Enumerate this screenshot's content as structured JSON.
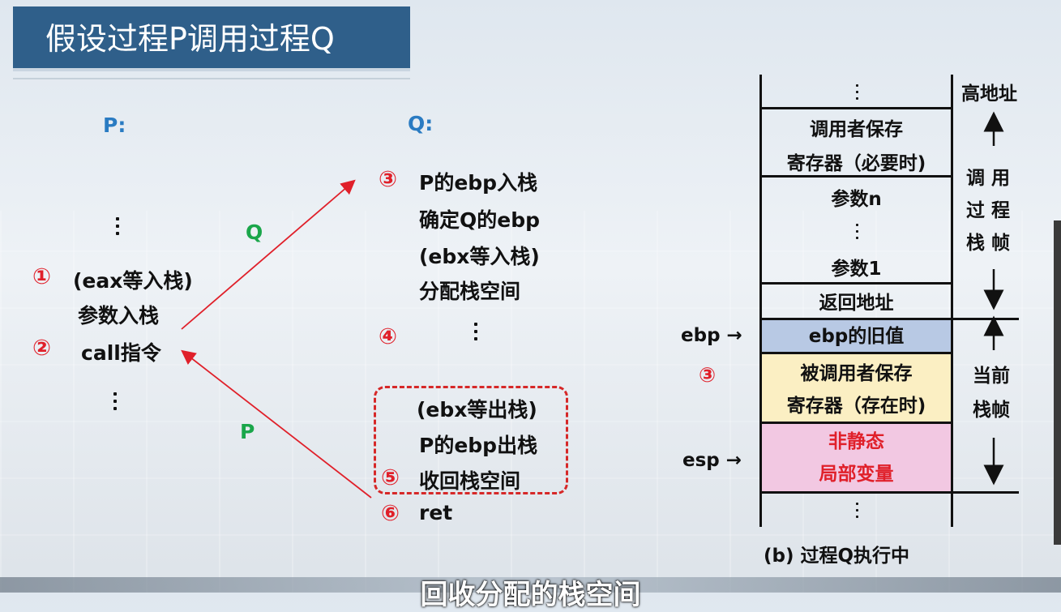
{
  "title": "假设过程P调用过程Q",
  "p_side": {
    "label": "P:",
    "step1_num": "①",
    "step1_text": "(eax等入栈)",
    "step1_sub": "参数入栈",
    "step2_num": "②",
    "step2_text": "call指令"
  },
  "arrows": {
    "call_label": "Q",
    "return_label": "P"
  },
  "q_side": {
    "label": "Q:",
    "step3_num": "③",
    "lines": [
      "P的ebp入栈",
      "确定Q的ebp",
      "(ebx等入栈)",
      "分配栈空间"
    ],
    "step4_num": "④",
    "cleanup_lines": [
      "(ebx等出栈)",
      "P的ebp出栈",
      "收回栈空间"
    ],
    "step5_num": "⑤",
    "step6_num": "⑥",
    "step6_text": "ret"
  },
  "stack": {
    "high_address": "高地址",
    "cells": {
      "caller_saved_1": "调用者保存",
      "caller_saved_2": "寄存器（必要时)",
      "param_n": "参数n",
      "param_1": "参数1",
      "return_addr": "返回地址",
      "old_ebp": "ebp的旧值",
      "callee_saved_1": "被调用者保存",
      "callee_saved_2": "寄存器（存在时)",
      "locals_1": "非静态",
      "locals_2": "局部变量"
    },
    "caller_frame": [
      "调 用",
      "过 程",
      "栈 帧"
    ],
    "current_frame": [
      "当前",
      "栈帧"
    ],
    "ebp_label": "ebp →",
    "esp_label": "esp →",
    "marker_num": "③",
    "caption": "(b) 过程Q执行中",
    "colors": {
      "old_ebp": "#b8c9e4",
      "callee_saved": "#fbefc3",
      "locals": "#f2c8e2",
      "locals_text": "#e0202a"
    }
  },
  "subtitle": "回收分配的栈空间"
}
